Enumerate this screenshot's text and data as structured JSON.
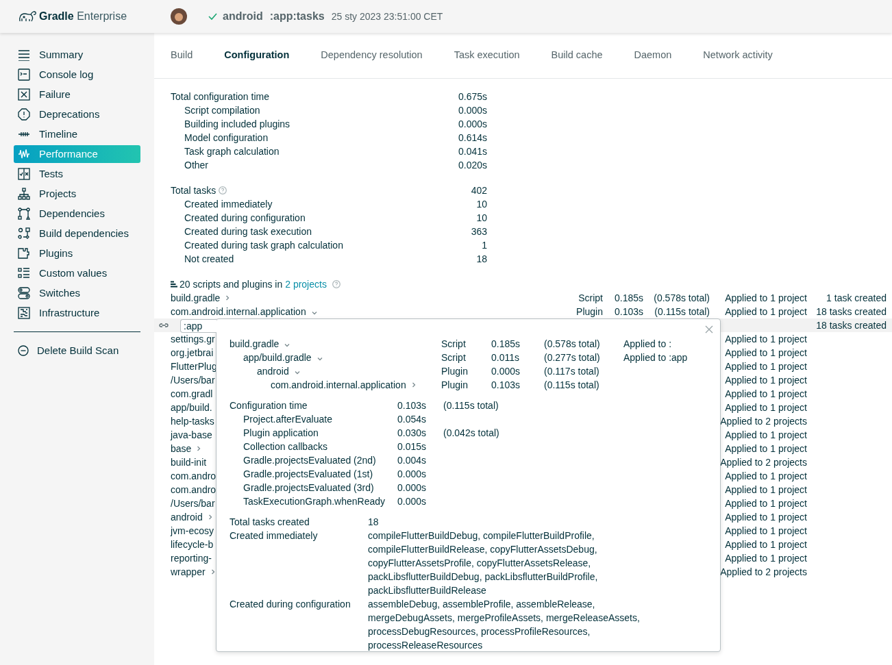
{
  "header": {
    "logo_bold": "Gradle",
    "logo_light": "Enterprise",
    "success": true,
    "project": "android",
    "tasks": ":app:tasks",
    "time": "25 sty 2023 23:51:00 CET"
  },
  "sidebar": {
    "items": [
      {
        "label": "Summary",
        "selected": false
      },
      {
        "label": "Console log",
        "selected": false
      },
      {
        "label": "Failure",
        "selected": false
      },
      {
        "label": "Deprecations",
        "selected": false
      },
      {
        "label": "Timeline",
        "selected": false
      },
      {
        "label": "Performance",
        "selected": true
      },
      {
        "label": "Tests",
        "selected": false
      },
      {
        "label": "Projects",
        "selected": false
      },
      {
        "label": "Dependencies",
        "selected": false
      },
      {
        "label": "Build dependencies",
        "selected": false
      },
      {
        "label": "Plugins",
        "selected": false
      },
      {
        "label": "Custom values",
        "selected": false
      },
      {
        "label": "Switches",
        "selected": false
      },
      {
        "label": "Infrastructure",
        "selected": false
      }
    ],
    "footer": "Delete Build Scan"
  },
  "tabs": [
    {
      "label": "Build",
      "selected": false
    },
    {
      "label": "Configuration",
      "selected": true
    },
    {
      "label": "Dependency resolution",
      "selected": false
    },
    {
      "label": "Task execution",
      "selected": false
    },
    {
      "label": "Build cache",
      "selected": false
    },
    {
      "label": "Daemon",
      "selected": false
    },
    {
      "label": "Network activity",
      "selected": false
    }
  ],
  "configuration": {
    "groups": [
      {
        "label": "Total configuration time",
        "value": "0.675s",
        "help": false,
        "children": [
          {
            "label": "Script compilation",
            "value": "0.000s"
          },
          {
            "label": "Building included plugins",
            "value": "0.000s"
          },
          {
            "label": "Model configuration",
            "value": "0.614s"
          },
          {
            "label": "Task graph calculation",
            "value": "0.041s"
          },
          {
            "label": "Other",
            "value": "0.020s"
          }
        ]
      },
      {
        "label": "Total tasks",
        "value": "402",
        "help": true,
        "children": [
          {
            "label": "Created immediately",
            "value": "10"
          },
          {
            "label": "Created during configuration",
            "value": "10"
          },
          {
            "label": "Created during task execution",
            "value": "363"
          },
          {
            "label": "Created during task graph calculation",
            "value": "1"
          },
          {
            "label": "Not created",
            "value": "18"
          }
        ]
      }
    ]
  },
  "scripts": {
    "title": "20 scripts and plugins in",
    "link": "2 projects",
    "rows": [
      {
        "kind": "row",
        "name": "build.gradle",
        "expanded": false,
        "type": "Script",
        "time": "0.185s",
        "total": "(0.578s total)",
        "applied": "Applied to 1 project",
        "tasks": "1 task created"
      },
      {
        "kind": "row",
        "name": "com.android.internal.application",
        "expanded": true,
        "type": "Plugin",
        "time": "0.103s",
        "total": "(0.115s total)",
        "applied": "Applied to 1 project",
        "tasks": "18 tasks created"
      },
      {
        "kind": "detail",
        "name": ":app",
        "tasks": "18 tasks created"
      },
      {
        "kind": "row",
        "name": "settings.gr",
        "applied": "Applied to 1 project"
      },
      {
        "kind": "row",
        "name": "org.jetbrai",
        "applied": "Applied to 1 project"
      },
      {
        "kind": "row",
        "name": "FlutterPlug",
        "applied": "Applied to 1 project"
      },
      {
        "kind": "row",
        "name": "/Users/bar",
        "applied": "Applied to 1 project"
      },
      {
        "kind": "row",
        "name": "com.gradl",
        "applied": "Applied to 1 project"
      },
      {
        "kind": "row",
        "name": "app/build.",
        "applied": "Applied to 1 project"
      },
      {
        "kind": "row",
        "name": "help-tasks",
        "applied": "Applied to 2 projects"
      },
      {
        "kind": "row",
        "name": "java-base",
        "applied": "Applied to 1 project"
      },
      {
        "kind": "row",
        "name": "base",
        "expanded": false,
        "applied": "Applied to 1 project"
      },
      {
        "kind": "row",
        "name": "build-init",
        "applied": "Applied to 2 projects"
      },
      {
        "kind": "row",
        "name": "com.andro",
        "applied": "Applied to 1 project"
      },
      {
        "kind": "row",
        "name": "com.andro",
        "applied": "Applied to 1 project"
      },
      {
        "kind": "row",
        "name": "/Users/bar",
        "applied": "Applied to 1 project"
      },
      {
        "kind": "row",
        "name": "android",
        "expanded": false,
        "applied": "Applied to 1 project"
      },
      {
        "kind": "row",
        "name": "jvm-ecosy",
        "applied": "Applied to 1 project"
      },
      {
        "kind": "row",
        "name": "lifecycle-b",
        "applied": "Applied to 1 project"
      },
      {
        "kind": "row",
        "name": "reporting-",
        "applied": "Applied to 1 project"
      },
      {
        "kind": "row",
        "name": "wrapper",
        "expanded": false,
        "applied": "Applied to 2 projects"
      }
    ]
  },
  "popover": {
    "tree": [
      {
        "name": "build.gradle",
        "expanded": true,
        "type": "Script",
        "time": "0.185s",
        "total": "(0.578s total)",
        "applied": "Applied to :",
        "children": [
          {
            "name": "app/build.gradle",
            "expanded": true,
            "type": "Script",
            "time": "0.011s",
            "total": "(0.277s total)",
            "applied": "Applied to :app",
            "children": [
              {
                "name": "android",
                "expanded": true,
                "type": "Plugin",
                "time": "0.000s",
                "total": "(0.117s total)",
                "children": [
                  {
                    "name": "com.android.internal.application",
                    "expanded": false,
                    "type": "Plugin",
                    "time": "0.103s",
                    "total": "(0.115s total)"
                  }
                ]
              }
            ]
          }
        ]
      }
    ],
    "config": {
      "label": "Configuration time",
      "value": "0.103s",
      "total": "(0.115s total)",
      "children": [
        {
          "label": "Project.afterEvaluate",
          "value": "0.054s"
        },
        {
          "label": "Plugin application",
          "value": "0.030s",
          "total": "(0.042s total)"
        },
        {
          "label": "Collection callbacks",
          "value": "0.015s"
        },
        {
          "label": "Gradle.projectsEvaluated (2nd)",
          "value": "0.004s"
        },
        {
          "label": "Gradle.projectsEvaluated (1st)",
          "value": "0.000s"
        },
        {
          "label": "Gradle.projectsEvaluated (3rd)",
          "value": "0.000s"
        },
        {
          "label": "TaskExecutionGraph.whenReady",
          "value": "0.000s"
        }
      ]
    },
    "tasks": [
      {
        "label": "Total tasks created",
        "value": "18"
      },
      {
        "label": "Created immediately",
        "value": "compileFlutterBuildDebug, compileFlutterBuildProfile, compileFlutterBuildRelease, copyFlutterAssetsDebug, copyFlutterAssetsProfile, copyFlutterAssetsRelease, packLibsflutterBuildDebug, packLibsflutterBuildProfile, packLibsflutterBuildRelease"
      },
      {
        "label": "Created during configuration",
        "value": "assembleDebug, assembleProfile, assembleRelease, mergeDebugAssets, mergeProfileAssets, mergeReleaseAssets, processDebugResources, processProfileResources, processReleaseResources"
      }
    ]
  }
}
